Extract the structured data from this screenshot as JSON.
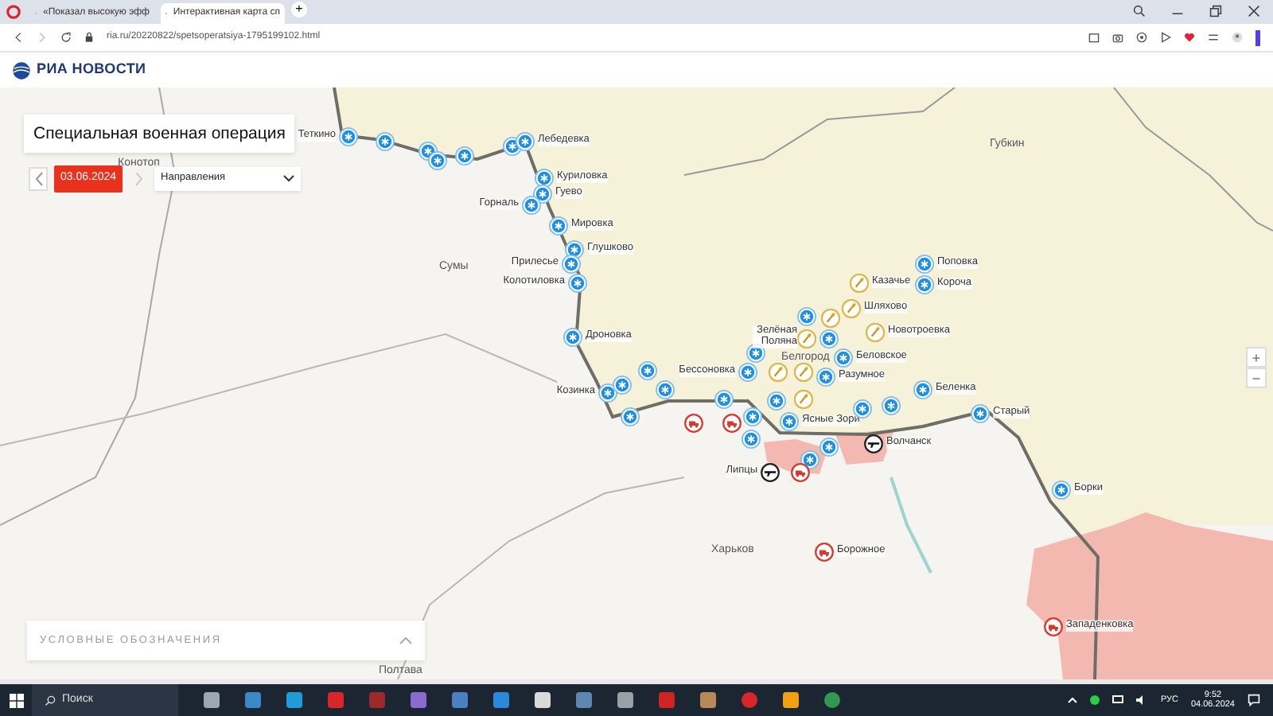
{
  "browser": {
    "tabs": [
      {
        "title": "«Показал высокую эфф",
        "selected": false
      },
      {
        "title": "Интерактивная карта сп",
        "selected": true
      }
    ],
    "new_tab": "+",
    "address": "ria.ru/20220822/spetsoperatsiya-1795199102.html"
  },
  "site": {
    "logo": "РИА НОВОСТИ"
  },
  "map": {
    "title": "Специальная военная операция",
    "date": "03.06.2024",
    "directions": "Направления",
    "legend": "УСЛОВНЫЕ ОБОЗНАЧЕНИЯ",
    "zoom_in": "+",
    "zoom_out": "−",
    "cities": [
      {
        "label": "Конотоп"
      },
      {
        "label": "Сумы"
      },
      {
        "label": "Губкин"
      },
      {
        "label": "Белгород"
      },
      {
        "label": "Харьков"
      },
      {
        "label": "Полтава"
      }
    ],
    "markers": [
      {
        "kind": "strike",
        "label": "Теткино"
      },
      {
        "kind": "strike"
      },
      {
        "kind": "strike"
      },
      {
        "kind": "strike"
      },
      {
        "kind": "strike"
      },
      {
        "kind": "strike"
      },
      {
        "kind": "strike",
        "label": "Лебедевка"
      },
      {
        "kind": "strike",
        "label": "Куриловка"
      },
      {
        "kind": "strike",
        "label": "Гуево"
      },
      {
        "kind": "strike",
        "label": "Горналь"
      },
      {
        "kind": "strike",
        "label": "Мировка"
      },
      {
        "kind": "strike",
        "label": "Глушково"
      },
      {
        "kind": "strike",
        "label": "Прилесье"
      },
      {
        "kind": "strike",
        "label": "Колотиловка"
      },
      {
        "kind": "strike",
        "label": "Дроновка"
      },
      {
        "kind": "strike",
        "label": "Козинка"
      },
      {
        "kind": "strike"
      },
      {
        "kind": "strike"
      },
      {
        "kind": "strike"
      },
      {
        "kind": "strike"
      },
      {
        "kind": "strike"
      },
      {
        "kind": "strike",
        "label": "Бессоновка"
      },
      {
        "kind": "strike"
      },
      {
        "kind": "strike"
      },
      {
        "kind": "strike"
      },
      {
        "kind": "strike"
      },
      {
        "kind": "strike"
      },
      {
        "kind": "strike",
        "label": "Беловское"
      },
      {
        "kind": "strike",
        "label": "Разумное"
      },
      {
        "kind": "strike"
      },
      {
        "kind": "strike",
        "label": "Ясные Зори"
      },
      {
        "kind": "strike"
      },
      {
        "kind": "strike"
      },
      {
        "kind": "strike"
      },
      {
        "kind": "strike"
      },
      {
        "kind": "strike",
        "label": "Беленка"
      },
      {
        "kind": "strike",
        "label": "Старый"
      },
      {
        "kind": "strike",
        "label": "Борки"
      },
      {
        "kind": "strike",
        "label": "Поповка"
      },
      {
        "kind": "rocket",
        "label": "Казачье"
      },
      {
        "kind": "strike",
        "label": "Короча"
      },
      {
        "kind": "rocket"
      },
      {
        "kind": "rocket",
        "label": "Шляхово"
      },
      {
        "kind": "rocket",
        "label": "Зелёная Поляна"
      },
      {
        "kind": "rocket",
        "label": "Новотроевка"
      },
      {
        "kind": "rocket"
      },
      {
        "kind": "rocket"
      },
      {
        "kind": "rocket"
      },
      {
        "kind": "vehicle"
      },
      {
        "kind": "vehicle"
      },
      {
        "kind": "vehicle"
      },
      {
        "kind": "vehicle",
        "label": "Борожное"
      },
      {
        "kind": "vehicle",
        "label": "Западенковка"
      },
      {
        "kind": "gun",
        "label": "Липцы"
      },
      {
        "kind": "gun",
        "label": "Волчанск"
      }
    ]
  },
  "taskbar": {
    "search": "Поиск",
    "language": "РУС",
    "time": "9:52",
    "date": "04.06.2024"
  }
}
